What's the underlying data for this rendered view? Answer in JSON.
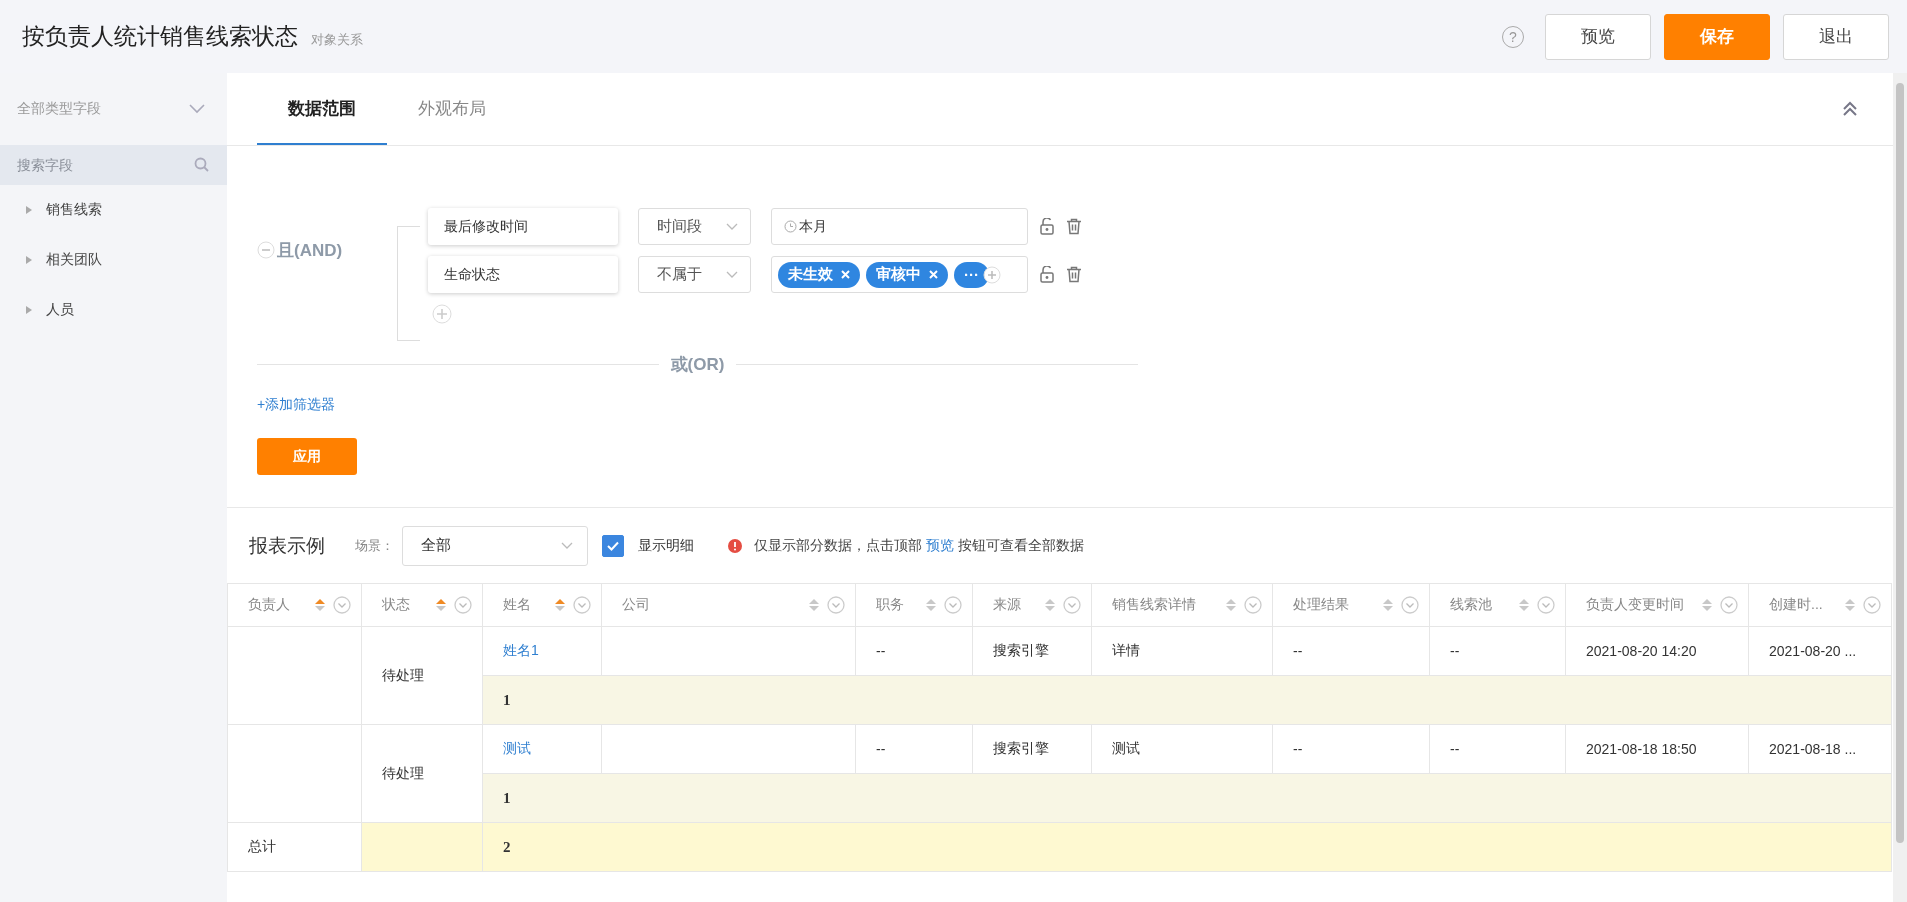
{
  "header": {
    "title": "按负责人统计销售线索状态",
    "subtitle": "对象关系",
    "help": "?",
    "buttons": [
      {
        "label": "预览",
        "kind": "default"
      },
      {
        "label": "保存",
        "kind": "primary"
      },
      {
        "label": "退出",
        "kind": "default"
      }
    ]
  },
  "sidebar": {
    "type_select": "全部类型字段",
    "search": {
      "placeholder": "搜索字段"
    },
    "items": [
      {
        "label": "销售线索",
        "expanded": false
      },
      {
        "label": "相关团队",
        "expanded": false
      },
      {
        "label": "人员",
        "expanded": false
      }
    ]
  },
  "tabs": [
    {
      "label": "数据范围",
      "selected": true
    },
    {
      "label": "外观布局",
      "selected": false
    }
  ],
  "filter": {
    "group_label": "且(AND)",
    "conditions": [
      {
        "field": "最后修改时间",
        "operator": "时间段",
        "kind": "date",
        "value": "本月"
      },
      {
        "field": "生命状态",
        "operator": "不属于",
        "kind": "tags",
        "tags": [
          {
            "label": "未生效",
            "removable": true
          },
          {
            "label": "审核中",
            "removable": true
          },
          {
            "label": "···",
            "removable": false
          }
        ]
      }
    ],
    "or_label": "或(OR)",
    "add_filter": "+添加筛选器",
    "apply": "应用"
  },
  "report": {
    "title": "报表示例",
    "scene_label": "场景：",
    "scene_value": "全部",
    "show_detail": {
      "label": "显示明细",
      "checked": true
    },
    "notice": {
      "before": "仅显示部分数据，点击顶部",
      "link": "预览",
      "after": "按钮可查看全部数据"
    }
  },
  "table": {
    "columns": [
      {
        "label": "负责人",
        "sorted": true
      },
      {
        "label": "状态",
        "sorted": true
      },
      {
        "label": "姓名",
        "sorted": true
      },
      {
        "label": "公司",
        "sorted": false
      },
      {
        "label": "职务",
        "sorted": false
      },
      {
        "label": "来源",
        "sorted": false
      },
      {
        "label": "销售线索详情",
        "sorted": false
      },
      {
        "label": "处理结果",
        "sorted": false
      },
      {
        "label": "线索池",
        "sorted": false
      },
      {
        "label": "负责人变更时间",
        "sorted": false
      },
      {
        "label": "创建时...",
        "sorted": false
      }
    ],
    "groups": [
      {
        "status": "待处理",
        "row": {
          "name": "姓名1",
          "position": "--",
          "source": "搜索引擎",
          "detail": "详情",
          "result": "--",
          "pool": "--",
          "owner_changed": "2021-08-20 14:20",
          "created": "2021-08-20 ..."
        },
        "subtotal": "1"
      },
      {
        "status": "待处理",
        "row": {
          "name": "测试",
          "position": "--",
          "source": "搜索引擎",
          "detail": "测试",
          "result": "--",
          "pool": "--",
          "owner_changed": "2021-08-18 18:50",
          "created": "2021-08-18 ..."
        },
        "subtotal": "1"
      }
    ],
    "total": {
      "label": "总计",
      "value": "2"
    }
  }
}
